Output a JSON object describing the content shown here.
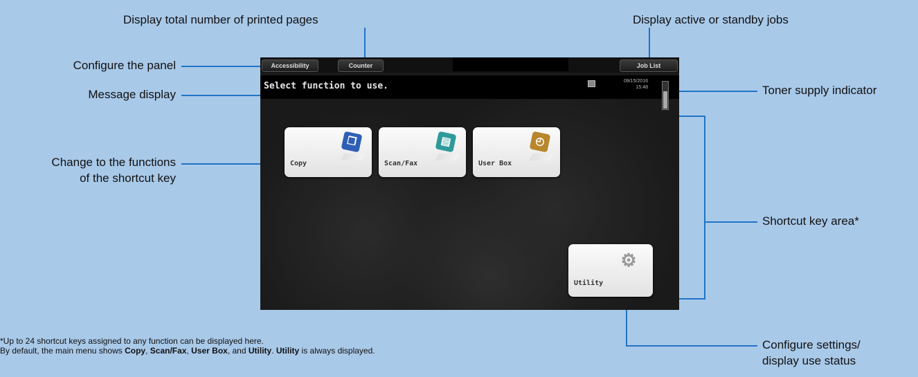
{
  "callouts": {
    "total_pages": "Display total number of printed pages",
    "jobs": "Display active or standby jobs",
    "configure_panel": "Configure the panel",
    "message_display": "Message display",
    "toner": "Toner supply indicator",
    "shortcut_change_line1": "Change to the functions",
    "shortcut_change_line2": "of the shortcut key",
    "shortcut_area": "Shortcut key area*",
    "utility_line1": "Configure settings/",
    "utility_line2": "display use status"
  },
  "screen": {
    "top_buttons": {
      "accessibility": "Accessibility",
      "counter": "Counter",
      "job_list": "Job List"
    },
    "message": "Select function to use.",
    "date": "09/15/2016",
    "time": "15:48",
    "toner_level": 0.65,
    "tiles": [
      {
        "label": "Copy",
        "icon": "copy-icon",
        "color": "#2f5fb5"
      },
      {
        "label": "Scan/Fax",
        "icon": "scan-fax-icon",
        "color": "#2f9a9a"
      },
      {
        "label": "User Box",
        "icon": "user-box-icon",
        "color": "#b8862b"
      }
    ],
    "utility": {
      "label": "Utility",
      "icon": "gear-icon"
    }
  },
  "footnote": {
    "line1": "*Up to 24 shortcut keys assigned to any function can be displayed here.",
    "line2_a": " By default, the main menu shows ",
    "copy": "Copy",
    "sep1": ", ",
    "scanfax": "Scan/Fax",
    "sep2": ", ",
    "userbox": "User Box",
    "sep3": ", and ",
    "utility": "Utility",
    "sep4": ". ",
    "utility2": "Utility",
    "line2_b": " is always displayed."
  },
  "colors": {
    "background": "#a9c9e9",
    "leader_line": "#1f74c4"
  }
}
